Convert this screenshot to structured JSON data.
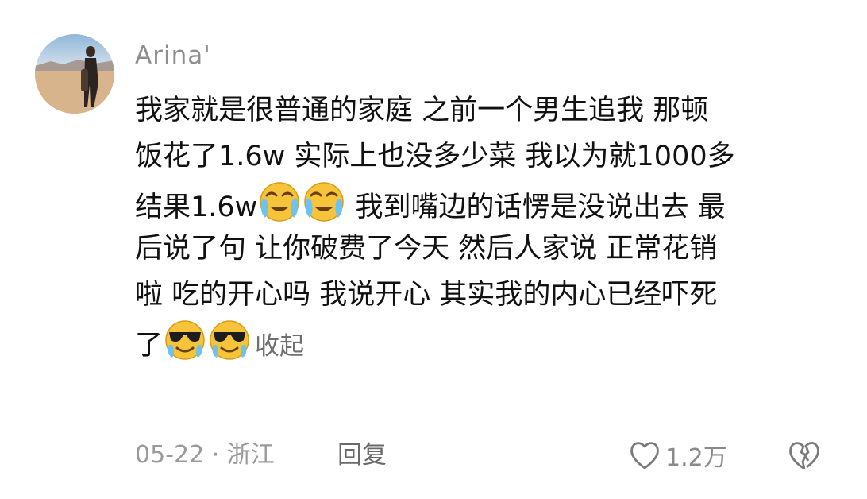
{
  "comment": {
    "username": "Arina'",
    "lines": [
      "我家就是很普通的家庭 之前一个男生追我 那顿",
      "饭花了1.6w 实际上也没多少菜 我以为就1000多",
      "结果1.6w",
      "我到嘴边的话愣是没说出去 最",
      "后说了句 让你破费了今天 然后人家说 正常花销",
      "啦 吃的开心吗 我说开心 其实我的内心已经吓死",
      "了"
    ],
    "emojis": {
      "line3": [
        "crying-laughing-emoji",
        "crying-laughing-emoji"
      ],
      "line7": [
        "sunglasses-emoji",
        "sunglasses-emoji"
      ]
    },
    "collapse_label": "收起",
    "date": "05-22 · 浙江",
    "reply_label": "回复",
    "like_count": "1.2万"
  },
  "icons": {
    "like": "heart-icon",
    "dislike": "broken-heart-icon"
  },
  "colors": {
    "text": "#111111",
    "username": "#8e8e8e",
    "meta": "#9a9a9a",
    "emoji_face": "#f5c43b",
    "emoji_tear": "#6cc3f0"
  }
}
